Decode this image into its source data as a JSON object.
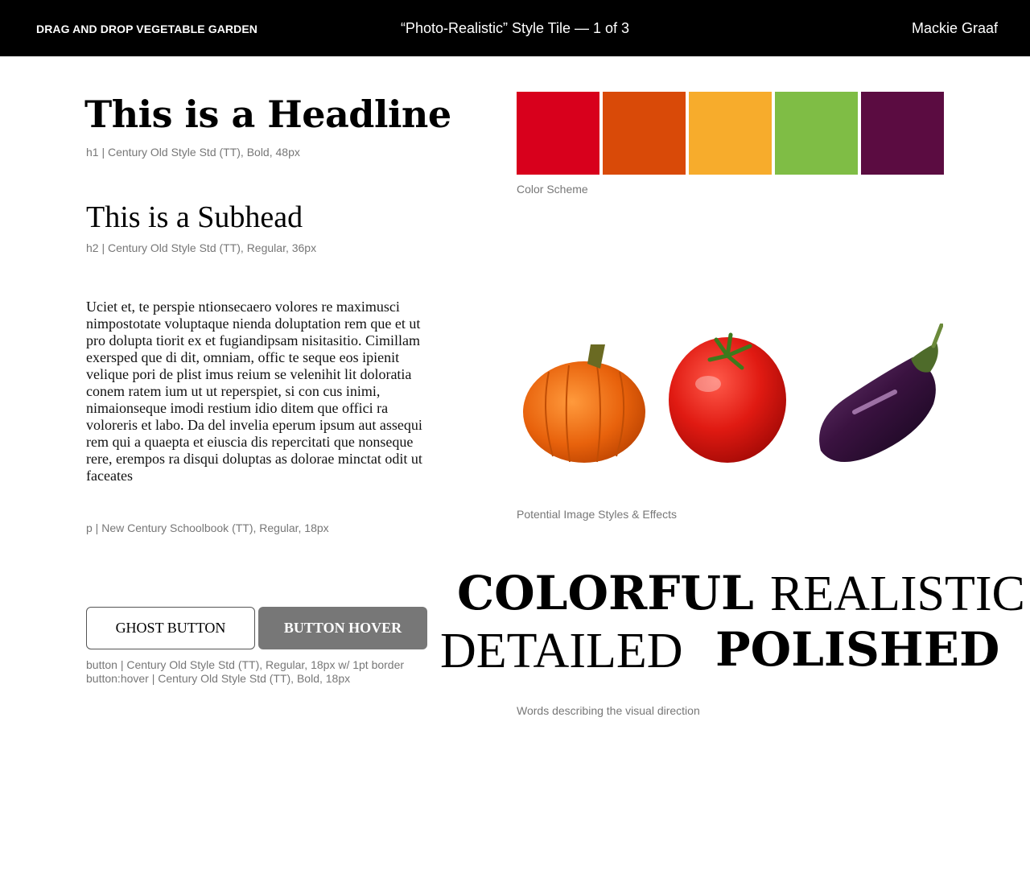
{
  "header": {
    "project": "DRAG AND DROP VEGETABLE GARDEN",
    "tile_title": "“Photo-Realistic” Style Tile — 1 of 3",
    "author": "Mackie Graaf"
  },
  "typography": {
    "headline": "This is a Headline",
    "headline_caption": "h1 | Century Old Style Std (TT), Bold, 48px",
    "subhead": "This is a Subhead",
    "subhead_caption": "h2 | Century Old Style Std (TT), Regular, 36px",
    "paragraph": "Uciet et, te perspie ntionsecaero volores re maximusci nimpostotate voluptaque nienda doluptation rem que et ut pro dolupta tiorit ex et fugiandipsam nisitasitio. Cimillam exersped que di dit, omniam, offic te seque eos ipienit velique pori de plist imus reium se velenihit lit doloratia conem ratem ium ut ut reperspiet, si con cus inimi, nimaionseque imodi restium idio ditem que offici ra voloreris et labo. Da del invelia eperum ipsum aut assequi rem qui a quaepta et eiuscia dis repercitati que nonseque rere, erempos ra disqui doluptas as dolorae minctat odit ut faceates",
    "paragraph_caption": "p | New Century Schoolbook (TT), Regular, 18px"
  },
  "buttons": {
    "ghost_label": "GHOST BUTTON",
    "hover_label": "BUTTON HOVER",
    "caption_line1": "button | Century Old Style Std (TT), Regular, 18px w/ 1pt border",
    "caption_line2": "button:hover | Century Old Style Std (TT), Bold, 18px"
  },
  "colors": {
    "swatches": [
      "#d8001c",
      "#d94a08",
      "#f7ac2c",
      "#7fbd45",
      "#5b0c41"
    ],
    "caption": "Color Scheme"
  },
  "images": {
    "items": [
      "pumpkin",
      "tomato",
      "eggplant"
    ],
    "caption": "Potential Image Styles & Effects"
  },
  "words": {
    "colorful": "COLORFUL",
    "realistic": "REALISTIC",
    "detailed": "DETAILED",
    "polished": "POLISHED",
    "caption": "Words describing the visual direction"
  }
}
